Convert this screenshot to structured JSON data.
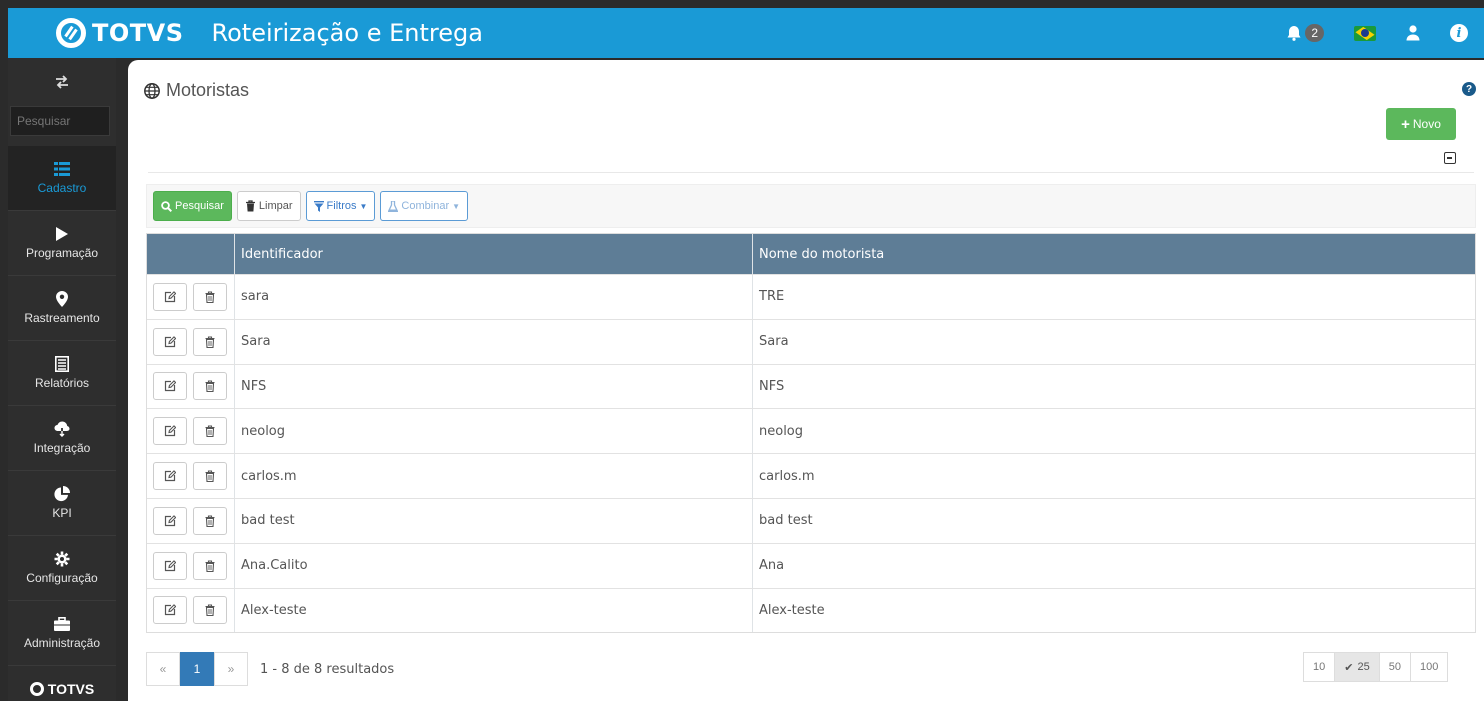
{
  "header": {
    "brand": "TOTVS",
    "app_title": "Roteirização e Entrega",
    "notification_count": "2",
    "accent_color": "#1a9ad6"
  },
  "sidebar": {
    "search_placeholder": "Pesquisar",
    "items": [
      {
        "label": "Cadastro",
        "icon": "list-icon",
        "active": true
      },
      {
        "label": "Programação",
        "icon": "play-icon"
      },
      {
        "label": "Rastreamento",
        "icon": "map-pin-icon"
      },
      {
        "label": "Relatórios",
        "icon": "report-icon"
      },
      {
        "label": "Integração",
        "icon": "cloud-download-icon"
      },
      {
        "label": "KPI",
        "icon": "pie-chart-icon"
      },
      {
        "label": "Configuração",
        "icon": "gear-icon"
      },
      {
        "label": "Administração",
        "icon": "briefcase-icon"
      }
    ],
    "footer_brand": "TOTVS"
  },
  "main": {
    "title": "Motoristas",
    "new_button": "Novo",
    "toolbar": {
      "search": "Pesquisar",
      "clear": "Limpar",
      "filters": "Filtros",
      "combine": "Combinar"
    },
    "table": {
      "columns": [
        "Identificador",
        "Nome do motorista"
      ],
      "rows": [
        {
          "id": "sara",
          "name": "TRE"
        },
        {
          "id": "Sara",
          "name": "Sara"
        },
        {
          "id": "NFS",
          "name": "NFS"
        },
        {
          "id": "neolog",
          "name": "neolog"
        },
        {
          "id": "carlos.m",
          "name": "carlos.m"
        },
        {
          "id": "bad test",
          "name": "bad test"
        },
        {
          "id": "Ana.Calito",
          "name": "Ana"
        },
        {
          "id": "Alex-teste",
          "name": "Alex-teste"
        }
      ]
    },
    "pagination": {
      "prev": "«",
      "current": "1",
      "next": "»",
      "summary": "1 - 8 de 8 resultados",
      "page_sizes": [
        "10",
        "25",
        "50",
        "100"
      ],
      "selected_size": "25"
    }
  }
}
